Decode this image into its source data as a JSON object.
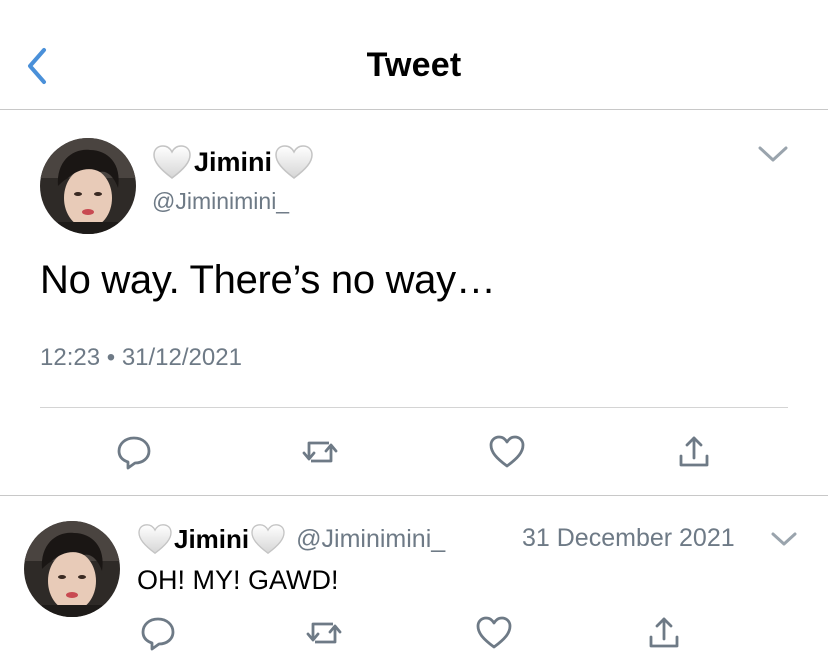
{
  "header": {
    "title": "Tweet",
    "back_icon": "chevron-left-icon"
  },
  "colors": {
    "accent": "#4a90d9",
    "secondary_text": "#6e7a86",
    "icon_gray": "#6e7a86",
    "divider": "#c8c8c8"
  },
  "tweet": {
    "display_name": "Jimini",
    "name_emoji": "white-heart-icon",
    "handle": "@Jiminimini_",
    "text": "No way. There’s no way…",
    "time": "12:23",
    "separator": "•",
    "date": "31/12/2021",
    "actions": [
      "reply-icon",
      "retweet-icon",
      "like-icon",
      "share-icon"
    ]
  },
  "reply": {
    "display_name": "Jimini",
    "handle": "@Jiminimini_",
    "date": "31 December 2021",
    "text": "OH! MY! GAWD!",
    "actions": [
      "reply-icon",
      "retweet-icon",
      "like-icon",
      "share-icon"
    ]
  }
}
